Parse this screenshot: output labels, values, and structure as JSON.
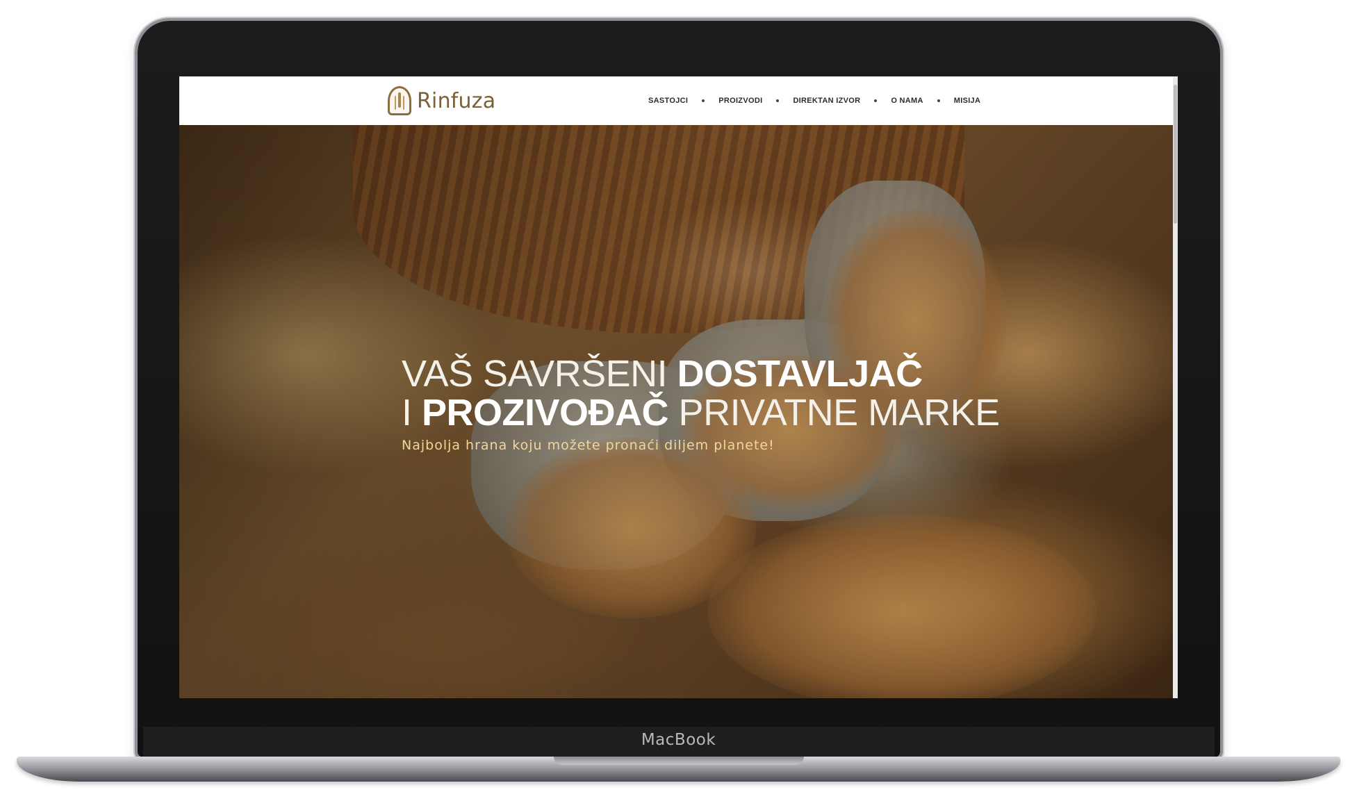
{
  "device": {
    "brand_label": "MacBook"
  },
  "site": {
    "logo_text": "Rinfuza",
    "nav": [
      "SASTOJCI",
      "PROIZVODI",
      "DIREKTAN IZVOR",
      "O NAMA",
      "MISIJA"
    ]
  },
  "hero": {
    "line1_light": "VAŠ SAVRŠENI ",
    "line1_bold": "DOSTAVLJAČ",
    "line2_light_a": "I ",
    "line2_bold": "PROZIVOĐAČ",
    "line2_light_b": " PRIVATNE MARKE",
    "subtitle": "Najbolja hrana koju možete pronaći diljem planete!",
    "image_icon": "wheat-grain-photo"
  },
  "colors": {
    "logo": "#7a6136",
    "subtitle": "#f1d79a",
    "nav_text": "#2b2b2b"
  }
}
